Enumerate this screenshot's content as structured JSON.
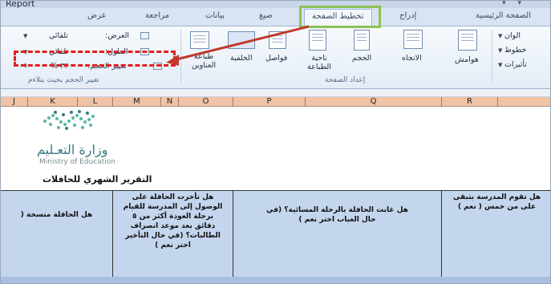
{
  "window": {
    "title": "Report"
  },
  "tabs": {
    "view": "عرض",
    "review": "مراجعة",
    "data": "بيانات",
    "formulas": "صيغ",
    "page_layout": "تخطيط الصفحة",
    "insert": "إدراج",
    "home": "الصفحة الرئيسية"
  },
  "ribbon": {
    "scale_group": {
      "width_label": "العرض:",
      "width_value": "تلقائي",
      "height_label": "الطول:",
      "height_value": "تلقائي",
      "scale_label": "تغيير الحجم:",
      "scale_value": "٣٣ %",
      "group_label": "تغيير الحجم بحيث يتلاءم"
    },
    "page_setup": {
      "titles": "طباعة العناوين",
      "background": "الخلفية",
      "breaks": "فواصل",
      "print_area": "ناحية الطباعة",
      "size": "الحجم",
      "orientation": "الاتجاه",
      "margins": "هوامش",
      "group_label": "إعداد الصفحة"
    },
    "themes": {
      "colors": "الوان",
      "fonts": "خطوط",
      "effects": "تأثيرات"
    }
  },
  "columns": [
    "J",
    "K",
    "L",
    "M",
    "N",
    "O",
    "P",
    "Q",
    "R"
  ],
  "sheet": {
    "ministry_ar": "وزارة التعـليم",
    "ministry_en": "Ministry of Education",
    "report_title": "التقرير الشهري للحافلات",
    "questions": [
      "هل الحافلة متسخة (",
      "هل تأخرت الحافلة على الوصول إلى المدرسة للقيام برحلة العودة أكثر من ٥ دقائق بعد موعد انصراف الطالبات؟ (في حال التأخير اختر نعم )",
      "هل غابت الحافلة بالرحلة المسائية؟ (في حال الغياب اختر نعم )",
      "هل تقوم المدرسة بتبقى على من خمس ( نعم )"
    ]
  },
  "colors": {
    "tab_highlight": "#8cc152",
    "scale_highlight": "#e02020",
    "column_header": "#f0c3a6",
    "question_band": "#c4d5ee"
  }
}
